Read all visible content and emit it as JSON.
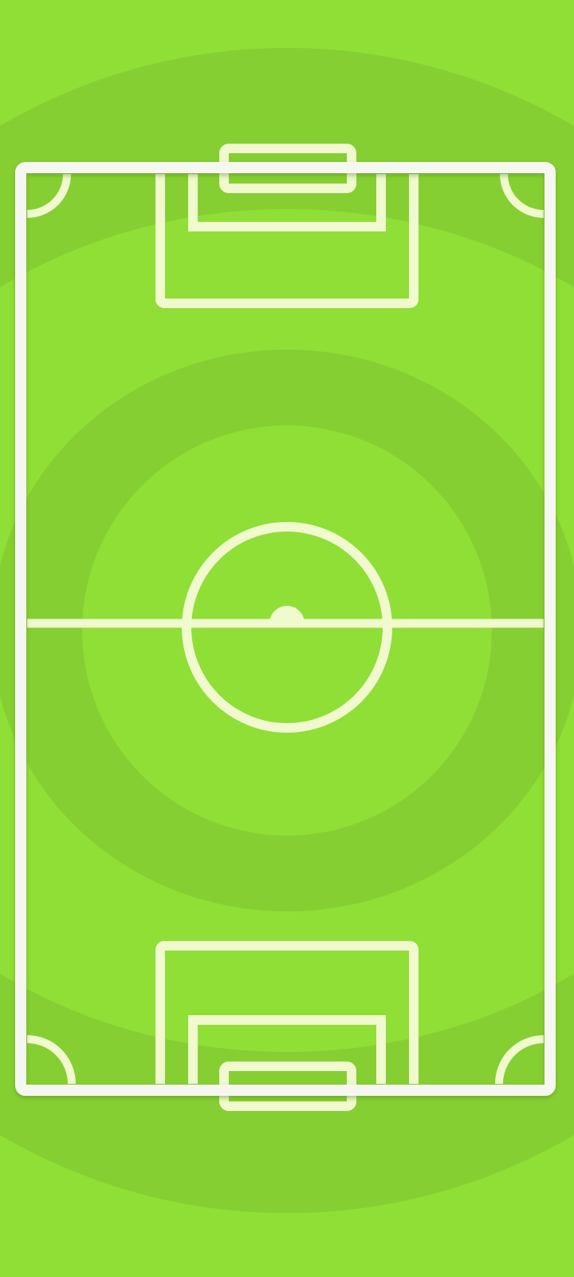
{
  "screen": {
    "kind": "soccer-pitch-board",
    "orientation": "portrait",
    "markings": [
      "outer-frame",
      "halfway-line",
      "center-circle",
      "center-spot",
      "top-penalty-box",
      "top-goal-box",
      "top-goal",
      "bottom-penalty-box",
      "bottom-goal-box",
      "bottom-goal",
      "corner-arcs"
    ]
  },
  "colors": {
    "grass_light": "#8fdf36",
    "grass_ring": "#86cf32",
    "pitch_lines": "#f1f9cf",
    "frame": "#f7f7f2",
    "frame_shadow": "#6fae25"
  }
}
